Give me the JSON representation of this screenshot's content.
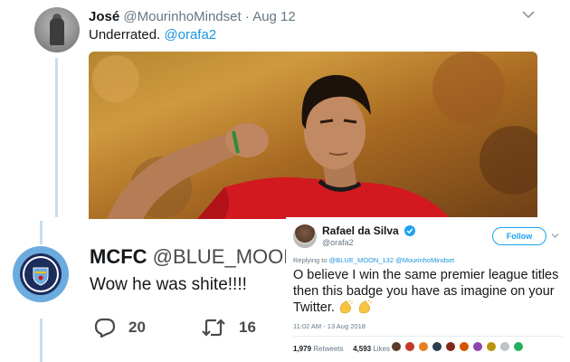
{
  "jose_tweet": {
    "name": "José",
    "handle": "@MourinhoMindset",
    "separator": "·",
    "date": "Aug 12",
    "text": "Underrated.",
    "mention": "@orafa2",
    "photo_icon": "football-celebration-photo"
  },
  "mcfc_reply": {
    "name": "MCFC",
    "handle": "@BLUE_MOON",
    "text": "Wow he was shite!!!!",
    "reply_count": "20",
    "retweet_count": "16",
    "avatar_icon": "manchester-city-badge"
  },
  "rafael_tweet": {
    "name": "Rafael da Silva",
    "handle": "@orafa2",
    "follow_label": "Follow",
    "replying_prefix": "Replying to",
    "replying_to": "@BLUE_MOON_132 @MourinhoMindset",
    "text": "O believe I win the same premier league titles then this badge you have as imagine on your Twitter.",
    "timestamp": "11:02 AM - 13 Aug 2018",
    "retweets_count": "1,979",
    "retweets_label": "Retweets",
    "likes_count": "4,593",
    "likes_label": "Likes",
    "liker_colors": [
      "#5b3a29",
      "#c0392b",
      "#e67e22",
      "#2c3e50",
      "#7f2a1c",
      "#d35400",
      "#8e44ad",
      "#b7950b",
      "#bdc3c7",
      "#27ae60"
    ]
  },
  "colors": {
    "link": "#1b95e0",
    "twitter_blue": "#1da1f2",
    "thread_line": "#c4dff5",
    "mcfc_sky": "#6cabdd"
  }
}
